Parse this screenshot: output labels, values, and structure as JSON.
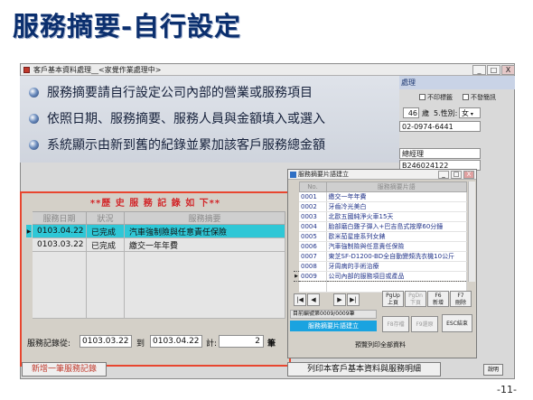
{
  "slide": {
    "title": "服務摘要-自行設定",
    "page_number": "-11-"
  },
  "window": {
    "title": "客戶基本資料處理__<家覺作業處理中>",
    "buttons": [
      "_",
      "□",
      "X"
    ]
  },
  "bullets": [
    "服務摘要請自行設定公司內部的營業或服務項目",
    "依照日期、服務摘要、服務人員與金額填入或選入",
    "系統顯示由新到舊的紀錄並累加該客戶服務總金額"
  ],
  "right_panel": {
    "header": "處理",
    "no_print_label": "不印標籤",
    "no_send_label": "不發簡訊",
    "age": "46",
    "age_unit": "歲",
    "sex_label": "5.性別:",
    "sex_value": "女",
    "phone": "02-0974-6441",
    "job_title": "總經理",
    "id_number": "B246024122"
  },
  "history": {
    "title": "**歷 史 服 務 記 錄 如 下**",
    "columns": [
      "服務日期",
      "狀況",
      "服務摘要"
    ],
    "rows": [
      {
        "date": "0103.04.22",
        "status": "已完成",
        "summary": "汽車強制險與任意責任保險"
      },
      {
        "date": "0103.03.22",
        "status": "已完成",
        "summary": "繳交一年年費"
      }
    ],
    "range_label": "服務記錄從:",
    "range_from": "0103.03.22",
    "to_label": "到",
    "range_to": "0103.04.22",
    "count_label": "計:",
    "count_value": "2",
    "amount_label": "筆",
    "add_button": "新增一筆服務記錄"
  },
  "dialog": {
    "title": "服務摘要片語建立",
    "buttons": [
      "_",
      "□",
      "X"
    ],
    "columns": [
      "No.",
      "服務摘要片語"
    ],
    "rows": [
      {
        "no": "0001",
        "text": "繳交一年年費"
      },
      {
        "no": "0002",
        "text": "牙齒冷光美白"
      },
      {
        "no": "0003",
        "text": "北歐五國純淨火車15天"
      },
      {
        "no": "0004",
        "text": "胎部磨白雞子彈入+巴吉島式按摩60分鐘"
      },
      {
        "no": "0005",
        "text": "歐米茄星座系列女錶"
      },
      {
        "no": "0006",
        "text": "汽車強制險與任意責任保險"
      },
      {
        "no": "0007",
        "text": "東芝SF-D1200-BD全自動變頻洗衣機10公斤"
      },
      {
        "no": "0008",
        "text": "牙周病的手術治療"
      },
      {
        "no": "0009",
        "text": "公司內部的服務項目或產品"
      }
    ],
    "nav": [
      "|◀",
      "◀",
      "▶",
      "▶|"
    ],
    "func_buttons": [
      {
        "key": "PgUp",
        "label": "上頁"
      },
      {
        "key": "PgDn",
        "label": "下頁"
      },
      {
        "key": "F6",
        "label": "新增"
      },
      {
        "key": "F7",
        "label": "刪除"
      }
    ],
    "status_text": "目前編號第0009/0009筆",
    "status_caption": "服務摘要片語建立",
    "f8_label": "F8存檔",
    "f9_label": "F9還原",
    "esc_label": "ESC結束",
    "preview_label": "預覽列印全部資料"
  },
  "footer": {
    "print_button": "列印本客戶基本資料與服務明細",
    "explain_button": "說明"
  }
}
